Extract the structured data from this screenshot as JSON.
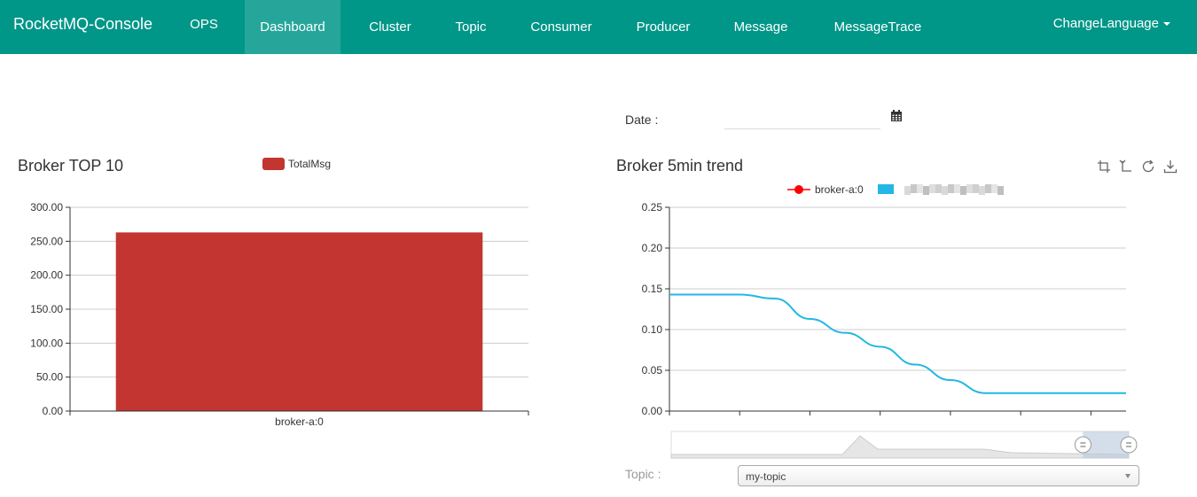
{
  "nav": {
    "brand": "RocketMQ-Console",
    "items": [
      {
        "label": "OPS"
      },
      {
        "label": "Dashboard",
        "active": true
      },
      {
        "label": "Cluster"
      },
      {
        "label": "Topic"
      },
      {
        "label": "Consumer"
      },
      {
        "label": "Producer"
      },
      {
        "label": "Message"
      },
      {
        "label": "MessageTrace"
      }
    ],
    "language": "ChangeLanguage",
    "color": "#009688",
    "active_color": "#26a69a"
  },
  "date_filter": {
    "label": "Date :",
    "value": "",
    "icon": "calendar-icon"
  },
  "topic_filter": {
    "label": "Topic :",
    "selected": "my-topic"
  },
  "toolbox": [
    "zoom-icon",
    "zoom-reset-icon",
    "restore-icon",
    "save-image-icon"
  ],
  "chart_data": [
    {
      "type": "bar",
      "title": "Broker TOP 10",
      "categories": [
        "broker-a:0"
      ],
      "series": [
        {
          "name": "TotalMsg",
          "values": [
            263
          ],
          "color": "#c23531"
        }
      ],
      "ylim": [
        0,
        300
      ],
      "yticks": [
        "0.00",
        "50.00",
        "100.00",
        "150.00",
        "200.00",
        "250.00",
        "300.00"
      ],
      "grid": true,
      "legend": "top-center"
    },
    {
      "type": "line",
      "title": "Broker 5min trend",
      "series": [
        {
          "name": "broker-a:0",
          "color": "#ff0000",
          "values": []
        },
        {
          "name": "",
          "color": "#23b7e5",
          "values": [
            0.143,
            0.143,
            0.143,
            0.138,
            0.113,
            0.096,
            0.079,
            0.057,
            0.038,
            0.022,
            0.022,
            0.022,
            0.022,
            0.022
          ]
        }
      ],
      "ylim": [
        0,
        0.25
      ],
      "yticks": [
        "0.00",
        "0.05",
        "0.10",
        "0.15",
        "0.20",
        "0.25"
      ],
      "grid": true,
      "legend": "top-center",
      "data_zoom": {
        "start": 0.9,
        "end": 1.0
      }
    }
  ]
}
